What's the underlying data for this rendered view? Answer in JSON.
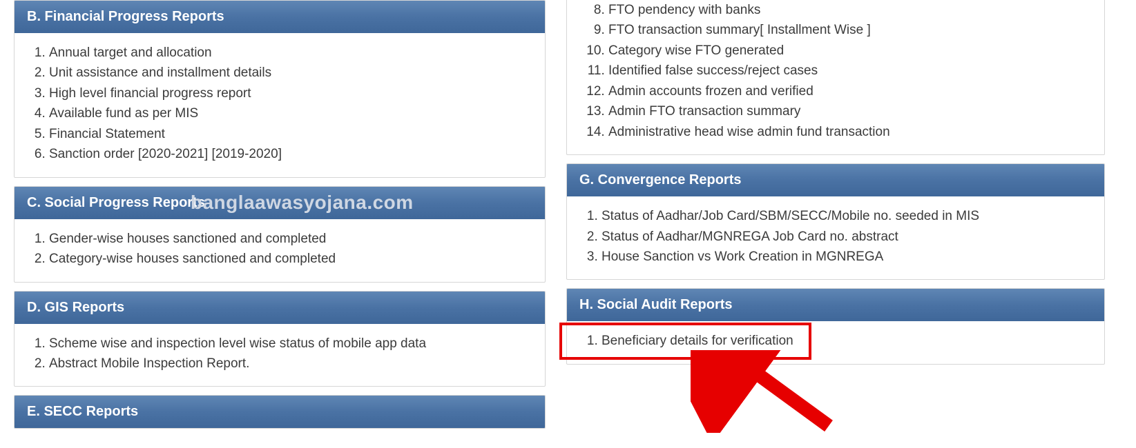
{
  "watermark": "banglaawasyojana.com",
  "left": {
    "sectionB": {
      "title": "B. Financial Progress Reports",
      "items": [
        "Annual target and allocation",
        "Unit assistance and installment details",
        "High level financial progress report",
        "Available fund as per MIS",
        "Financial Statement",
        "Sanction order [2020-2021] [2019-2020]"
      ]
    },
    "sectionC": {
      "title": "C. Social Progress Reports",
      "items": [
        "Gender-wise houses sanctioned and completed",
        "Category-wise houses sanctioned and completed"
      ]
    },
    "sectionD": {
      "title": "D. GIS Reports",
      "items": [
        "Scheme wise and inspection level wise status of mobile app data",
        "Abstract Mobile Inspection Report."
      ]
    },
    "sectionE": {
      "title": "E. SECC Reports"
    }
  },
  "right": {
    "sectionF_cont": {
      "items": [
        "FTO pendency with banks",
        "FTO transaction summary[ Installment Wise ]",
        "Category wise FTO generated",
        "Identified false success/reject cases",
        "Admin accounts frozen and verified",
        "Admin FTO transaction summary",
        "Administrative head wise admin fund transaction"
      ]
    },
    "sectionG": {
      "title": "G. Convergence Reports",
      "items": [
        "Status of Aadhar/Job Card/SBM/SECC/Mobile no. seeded in MIS",
        "Status of Aadhar/MGNREGA Job Card no. abstract",
        "House Sanction vs Work Creation in MGNREGA"
      ]
    },
    "sectionH": {
      "title": "H. Social Audit Reports",
      "items": [
        "Beneficiary details for verification"
      ]
    }
  }
}
